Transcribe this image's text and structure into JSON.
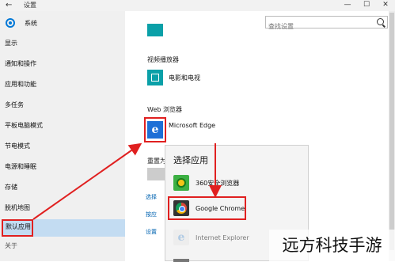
{
  "titlebar": {
    "back": "←",
    "title": "设置",
    "minimize": "—",
    "maximize": "☐",
    "close": "✕"
  },
  "sidebar": {
    "header": "系统",
    "items": [
      {
        "label": "显示"
      },
      {
        "label": "通知和操作"
      },
      {
        "label": "应用和功能"
      },
      {
        "label": "多任务"
      },
      {
        "label": "平板电脑模式"
      },
      {
        "label": "节电模式"
      },
      {
        "label": "电源和睡眠"
      },
      {
        "label": "存储"
      },
      {
        "label": "脱机地图"
      },
      {
        "label": "默认应用"
      }
    ],
    "about": "关于"
  },
  "search": {
    "placeholder": "查找设置"
  },
  "main": {
    "video_section": "视频播放器",
    "video_app": "电影和电视",
    "web_section": "Web 浏览器",
    "web_app": "Microsoft Edge",
    "reset_label": "重置为",
    "links": [
      "选择",
      "按应",
      "设置"
    ]
  },
  "popup": {
    "title": "选择应用",
    "items": [
      {
        "label": "360安全浏览器"
      },
      {
        "label": "Google Chrome"
      },
      {
        "label": "Internet Explorer"
      }
    ]
  },
  "watermark": "远方科技手游",
  "colors": {
    "accent": "#0078d7",
    "highlight": "#e02020",
    "selected": "#c3dcf2"
  }
}
